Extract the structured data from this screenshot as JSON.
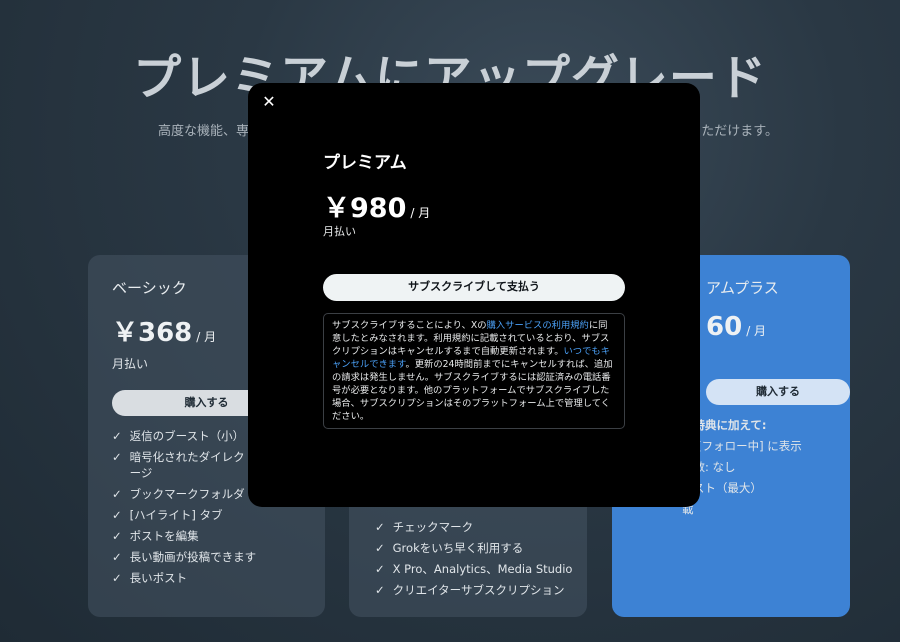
{
  "page": {
    "title": "プレミアムにアップグレード",
    "subtitle_left": "高度な機能、専",
    "subtitle_right": "ただけます。"
  },
  "plans": {
    "basic": {
      "name": "ベーシック",
      "price": "￥368",
      "per": "/ 月",
      "billing": "月払い",
      "button": "購入する",
      "features": [
        "返信のブースト（小）",
        "暗号化されたダイレクトメッセージ",
        "ブックマークフォルダ",
        "[ハイライト] タブ",
        "ポストを編集",
        "長い動画が投稿できます",
        "長いポスト"
      ]
    },
    "premium": {
      "features": [
        "チェックマーク",
        "Grokをいち早く利用する",
        "X Pro、Analytics、Media Studio",
        "クリエイターサブスクリプション"
      ]
    },
    "plus": {
      "name_partial": "アムプラス",
      "price_partial": "60",
      "per": "/ 月",
      "button": "購入する",
      "features": [
        "全特典に加えて:",
        "と [フォロー中] に表示",
        "告数: なし",
        "ースト（最大）",
        "載"
      ]
    }
  },
  "modal": {
    "close": "✕",
    "plan_name": "プレミアム",
    "price": "￥980",
    "per": "/ 月",
    "billing": "月払い",
    "subscribe_button": "サブスクライブして支払う",
    "terms": {
      "t1": "サブスクライブすることにより、Xの",
      "link1": "購入サービスの利用規約",
      "t2": "に同意したとみなされます。利用規約に記載されているとおり、サブスクリプションはキャンセルするまで自動更新されます。",
      "link2": "いつでもキャンセルできます",
      "t3": "。更新の24時間前までにキャンセルすれば、追加の請求は発生しません。サブスクライブするには認証済みの電話番号が必要となります。他のプラットフォームでサブスクライブした場合、サブスクリプションはそのプラットフォーム上で管理してください。"
    }
  }
}
